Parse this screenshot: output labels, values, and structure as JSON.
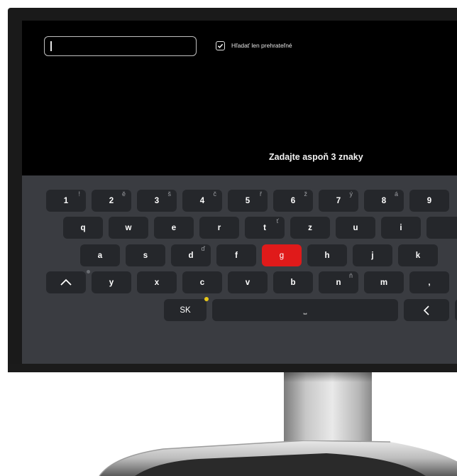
{
  "search": {
    "value": "",
    "placeholder": ""
  },
  "filter": {
    "label": "Hľadať len prehrateľné",
    "checked": true
  },
  "hint": "Zadajte aspoň 3 znaky",
  "keyboard": {
    "row1": [
      {
        "label": "1",
        "alt": "!"
      },
      {
        "label": "2",
        "alt": "ě"
      },
      {
        "label": "3",
        "alt": "š"
      },
      {
        "label": "4",
        "alt": "č"
      },
      {
        "label": "5",
        "alt": "ř"
      },
      {
        "label": "6",
        "alt": "ž"
      },
      {
        "label": "7",
        "alt": "ý"
      },
      {
        "label": "8",
        "alt": "á"
      },
      {
        "label": "9",
        "alt": ""
      }
    ],
    "row2": [
      {
        "label": "q",
        "alt": ""
      },
      {
        "label": "w",
        "alt": ""
      },
      {
        "label": "e",
        "alt": ""
      },
      {
        "label": "r",
        "alt": ""
      },
      {
        "label": "t",
        "alt": "ť"
      },
      {
        "label": "z",
        "alt": ""
      },
      {
        "label": "u",
        "alt": ""
      },
      {
        "label": "i",
        "alt": ""
      },
      {
        "label": "",
        "alt": ""
      }
    ],
    "row3": [
      {
        "label": "a",
        "alt": ""
      },
      {
        "label": "s",
        "alt": ""
      },
      {
        "label": "d",
        "alt": "ď"
      },
      {
        "label": "f",
        "alt": ""
      },
      {
        "label": "g",
        "alt": "",
        "active": true
      },
      {
        "label": "h",
        "alt": ""
      },
      {
        "label": "j",
        "alt": ""
      },
      {
        "label": "k",
        "alt": ""
      }
    ],
    "row4": [
      {
        "label": "y",
        "alt": ""
      },
      {
        "label": "x",
        "alt": ""
      },
      {
        "label": "c",
        "alt": ""
      },
      {
        "label": "v",
        "alt": ""
      },
      {
        "label": "b",
        "alt": ""
      },
      {
        "label": "n",
        "alt": "ň"
      },
      {
        "label": "m",
        "alt": ""
      },
      {
        "label": ",",
        "alt": ""
      }
    ],
    "lang_label": "SK",
    "space_symbol": "⎵",
    "active_color": "#e01a1a"
  }
}
